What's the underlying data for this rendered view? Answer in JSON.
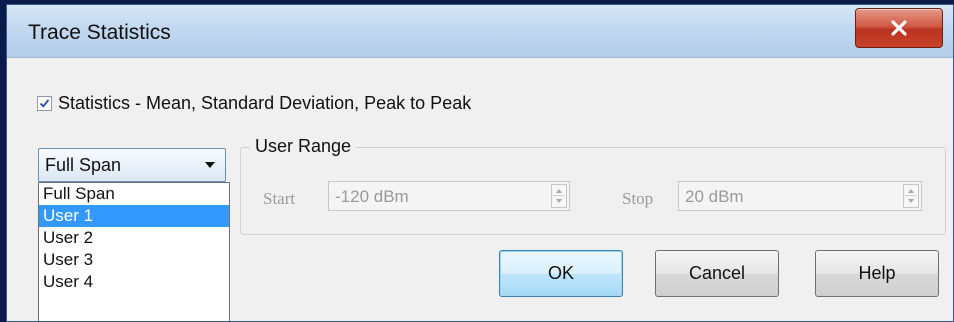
{
  "window": {
    "title": "Trace Statistics"
  },
  "statistics": {
    "checked": true,
    "label": "Statistics - Mean, Standard Deviation, Peak to Peak"
  },
  "range_select": {
    "value": "Full Span",
    "options": [
      "Full Span",
      "User 1",
      "User 2",
      "User 3",
      "User 4"
    ],
    "highlighted": "User 1"
  },
  "user_range": {
    "title": "User Range",
    "start_label": "Start",
    "start_value": "-120 dBm",
    "stop_label": "Stop",
    "stop_value": "20 dBm"
  },
  "buttons": {
    "ok": "OK",
    "cancel": "Cancel",
    "help": "Help"
  },
  "colors": {
    "selection": "#3399ff",
    "close_button": "#c9432b"
  }
}
